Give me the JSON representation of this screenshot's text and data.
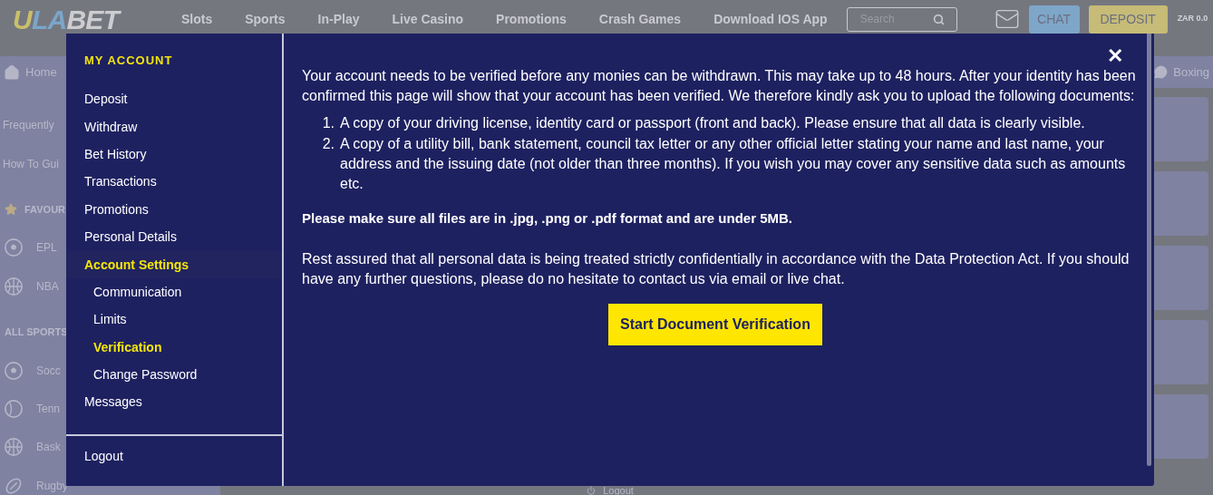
{
  "header": {
    "logo": [
      {
        "text": "U",
        "color": "#c9bf6b"
      },
      {
        "text": "LA",
        "color": "#7ba6c9"
      },
      {
        "text": "BET",
        "color": "#cdcdd0"
      }
    ],
    "nav": [
      "Slots",
      "Sports",
      "In-Play",
      "Live Casino",
      "Promotions",
      "Crash Games",
      "Download IOS App"
    ],
    "search": {
      "placeholder": "Search"
    },
    "chat": "CHAT",
    "deposit": "DEPOSIT",
    "balance": "ZAR 0.0"
  },
  "background": {
    "tabs": [
      {
        "label": "Home",
        "kind": "home"
      },
      {
        "label": "Boxing",
        "kind": "boxing"
      }
    ],
    "sidebar": [
      {
        "kind": "link",
        "label": "Frequently"
      },
      {
        "kind": "link",
        "label": "How To Gui"
      },
      {
        "kind": "favourites",
        "label": "FAVOUR"
      },
      {
        "kind": "soccer",
        "label": "EPL"
      },
      {
        "kind": "basketball",
        "label": "NBA"
      },
      {
        "kind": "heading",
        "label": "ALL SPORTS"
      },
      {
        "kind": "soccer",
        "label": "Socc"
      },
      {
        "kind": "tennis",
        "label": "Tenn"
      },
      {
        "kind": "basketball",
        "label": "Bask"
      },
      {
        "kind": "rugby",
        "label": "Rugby"
      }
    ],
    "footer_link": "Logout"
  },
  "modal": {
    "menu_title": "MY ACCOUNT",
    "menu": [
      {
        "label": "Deposit",
        "selected": false
      },
      {
        "label": "Withdraw",
        "selected": false
      },
      {
        "label": "Bet History",
        "selected": false
      },
      {
        "label": "Transactions",
        "selected": false
      },
      {
        "label": "Promotions",
        "selected": false
      },
      {
        "label": "Personal Details",
        "selected": false
      },
      {
        "label": "Account Settings",
        "selected": true,
        "children": [
          {
            "label": "Communication",
            "selected": false
          },
          {
            "label": "Limits",
            "selected": false
          },
          {
            "label": "Verification",
            "selected": true
          },
          {
            "label": "Change Password",
            "selected": false
          }
        ]
      },
      {
        "label": "Messages",
        "selected": false
      }
    ],
    "logout": "Logout",
    "close": "✕",
    "intro": "Your account needs to be verified before any monies can be withdrawn. This may take up to 48 hours. After your identity has been confirmed this page will show that your account has been verified. We therefore kindly ask you to upload the following documents:",
    "requirements": [
      {
        "number": "1.",
        "text": "A copy of your driving license, identity card or passport (front and back). Please ensure that all data is clearly visible."
      },
      {
        "number": "2.",
        "text": "A copy of a utility bill, bank statement, council tax letter or any other official letter stating your name and last name, your address and the issuing date (not older than three months). If you wish you may cover any sensitive data such as amounts etc."
      }
    ],
    "format_note": "Please make sure all files are in .jpg, .png or .pdf format and are under 5MB.",
    "privacy_note": "Rest assured that all personal data is being treated strictly confidentially in accordance with the Data Protection Act. If you should have any further questions, please do no hesitate to contact us via email or live chat.",
    "action": "Start Document Verification"
  }
}
